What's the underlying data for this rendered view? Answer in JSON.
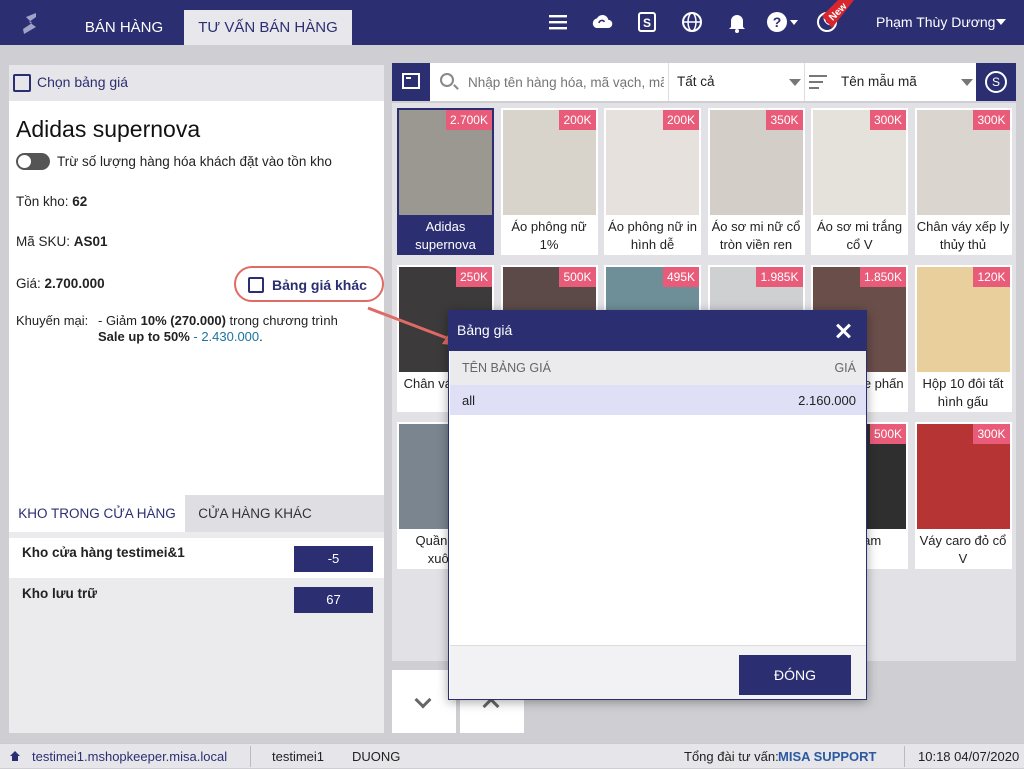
{
  "header": {
    "tabs": [
      {
        "label": "BÁN HÀNG"
      },
      {
        "label": "TƯ VẤN BÁN HÀNG"
      }
    ],
    "user_name": "Phạm Thùy Dương",
    "new_badge": "New",
    "icons": [
      "menu-icon",
      "cloud-sync-icon",
      "currency-icon",
      "globe-icon",
      "bell-icon",
      "help-icon",
      "phone-icon"
    ]
  },
  "left_panel": {
    "header_label": "Chọn bảng giá",
    "product_name": "Adidas supernova",
    "toggle_label": "Trừ số lượng hàng hóa khách đặt vào tồn kho",
    "stock_label": "Tồn kho:",
    "stock_value": "62",
    "sku_label": "Mã SKU:",
    "sku_value": "AS01",
    "price_label": "Giá:",
    "price_value": "2.700.000",
    "other_price_button": "Bảng giá khác",
    "promo_label": "Khuyến mại:",
    "promo_line1_prefix": "- Giảm ",
    "promo_line1_bold": "10% (270.000)",
    "promo_line1_suffix": " trong chương trình",
    "promo_program": "Sale up to 50%",
    "promo_sep": " - ",
    "promo_price": "2.430.000",
    "promo_end": "."
  },
  "warehouse": {
    "tabs": [
      {
        "label": "KHO TRONG CỬA HÀNG"
      },
      {
        "label": "CỬA HÀNG KHÁC"
      }
    ],
    "rows": [
      {
        "name": "Kho cửa hàng testimei&1",
        "qty": "-5"
      },
      {
        "name": "Kho lưu trữ",
        "qty": "67"
      }
    ]
  },
  "toolbar": {
    "search_placeholder": "Nhập tên hàng hóa, mã vạch, mã",
    "filter_value": "Tất cả",
    "sort_value": "Tên mẫu mã",
    "s_button": "S"
  },
  "products": [
    {
      "name": "Adidas supernova",
      "price": "2.700K"
    },
    {
      "name": "Áo phông nữ 1%",
      "price": "200K"
    },
    {
      "name": "Áo phông nữ in hình dễ",
      "price": "200K"
    },
    {
      "name": "Áo sơ mi nữ cổ tròn viền ren",
      "price": "350K"
    },
    {
      "name": "Áo sơ mi trắng cổ V",
      "price": "300K"
    },
    {
      "name": "Chân váy xếp ly thủy thủ",
      "price": "300K"
    },
    {
      "name": "Chân váy tầng",
      "price": "250K"
    },
    {
      "name": "",
      "price": "500K"
    },
    {
      "name": "",
      "price": "495K"
    },
    {
      "name": "",
      "price": "1.985K"
    },
    {
      "name": "Converse phấn",
      "price": "1.850K"
    },
    {
      "name": "Hộp 10 đôi tất hình gấu",
      "price": "120K"
    },
    {
      "name": "Quần jean xuông",
      "price": ""
    },
    {
      "name": "",
      "price": ""
    },
    {
      "name": "",
      "price": ""
    },
    {
      "name": "",
      "price": ""
    },
    {
      "name": "ng nam",
      "price": "500K"
    },
    {
      "name": "Váy caro đỏ cổ V",
      "price": "300K"
    }
  ],
  "modal": {
    "title": "Bảng giá",
    "col_name": "TÊN BẢNG GIÁ",
    "col_price": "GIÁ",
    "rows": [
      {
        "name": "all",
        "price": "2.160.000"
      }
    ],
    "close_button": "ĐÓNG"
  },
  "status": {
    "url": "testimei1.mshopkeeper.misa.local",
    "store": "testimei1",
    "user": "DUONG",
    "hotline_label": "Tổng đài tư vấn:",
    "support": "MISA SUPPORT",
    "datetime": "10:18 04/07/2020"
  },
  "colors": {
    "brand": "#2b2f72",
    "badge": "#e85c7a",
    "highlight": "#e06a64",
    "promo_link": "#1a74a4"
  }
}
